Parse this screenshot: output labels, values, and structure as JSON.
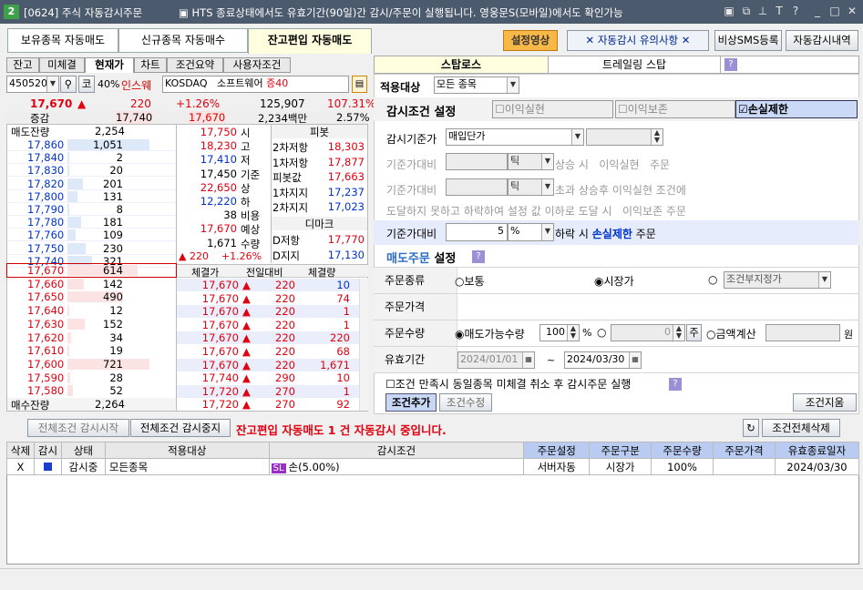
{
  "window": {
    "num": "2",
    "title": "[0624] 주식 자동감시주문",
    "message": "▣ HTS 종료상태에서도 유효기간(90일)간 감시/주문이 실행됩니다. 영웅문S(모바일)에서도 확인가능",
    "icons": [
      "window-icon",
      "restore-icon",
      "pin-icon",
      "font-size-icon",
      "help-icon",
      "minimize-icon",
      "maximize-icon",
      "close-icon"
    ]
  },
  "tabs": [
    "보유종목 자동매도",
    "신규종목 자동매수",
    "잔고편입 자동매도"
  ],
  "top_buttons": {
    "video": "설정영상",
    "caution": "✕ 자동감시 유의사항 ✕",
    "sms": "비상SMS등록",
    "history": "자동감시내역"
  },
  "left_tabs": [
    "잔고",
    "미체결",
    "현재가",
    "차트",
    "조건요약",
    "사용자조건"
  ],
  "stock": {
    "code": "450520",
    "pct_btn": "40%",
    "name_tag": "인스웨",
    "market": "KOSDAQ",
    "sector": "소프트웨어",
    "margin": "증40"
  },
  "price_row1": {
    "price": "17,670",
    "arrow": "▲",
    "change": "220",
    "rate": "+1.26%",
    "volume": "125,907",
    "volume_rate": "107.31%"
  },
  "price_row2": {
    "label": "증감",
    "prev": "17,740",
    "cur": "17,670",
    "amount": "2,234백만",
    "ratio": "2.57%"
  },
  "asks_header": {
    "label": "매도잔량",
    "total": "2,254"
  },
  "asks": [
    [
      "17,860",
      "1,051"
    ],
    [
      "17,840",
      "2"
    ],
    [
      "17,830",
      "20"
    ],
    [
      "17,820",
      "201"
    ],
    [
      "17,800",
      "131"
    ],
    [
      "17,790",
      "8"
    ],
    [
      "17,780",
      "181"
    ],
    [
      "17,760",
      "109"
    ],
    [
      "17,750",
      "230"
    ],
    [
      "17,740",
      "321"
    ]
  ],
  "bids": [
    [
      "17,670",
      "614"
    ],
    [
      "17,660",
      "142"
    ],
    [
      "17,650",
      "490"
    ],
    [
      "17,640",
      "12"
    ],
    [
      "17,630",
      "152"
    ],
    [
      "17,620",
      "34"
    ],
    [
      "17,610",
      "19"
    ],
    [
      "17,600",
      "721"
    ],
    [
      "17,590",
      "28"
    ],
    [
      "17,580",
      "52"
    ]
  ],
  "bids_footer": {
    "label": "매수잔량",
    "total": "2,264"
  },
  "info": [
    [
      "17,750",
      "시"
    ],
    [
      "18,230",
      "고"
    ],
    [
      "17,410",
      "저"
    ],
    [
      "17,450",
      "기준"
    ],
    [
      "22,650",
      "상"
    ],
    [
      "12,220",
      "하"
    ],
    [
      "38",
      "비용"
    ],
    [
      "17,670",
      "예상"
    ],
    [
      "1,671",
      "수량"
    ]
  ],
  "info_last": {
    "arrow": "▲",
    "change": "220",
    "rate": "+1.26%"
  },
  "pivot": {
    "header": "피봇",
    "rows": [
      [
        "2차저항",
        "18,303"
      ],
      [
        "1차저항",
        "17,877"
      ],
      [
        "피봇값",
        "17,663"
      ],
      [
        "1차지지",
        "17,237"
      ],
      [
        "2차지지",
        "17,023"
      ]
    ],
    "demark": "디마크",
    "demark_rows": [
      [
        "D저항",
        "17,770"
      ],
      [
        "D지지",
        "17,130"
      ]
    ]
  },
  "trades_header": [
    "체결가",
    "전일대비",
    "체결량"
  ],
  "trades": [
    [
      "17,670",
      "220",
      "10"
    ],
    [
      "17,670",
      "220",
      "74"
    ],
    [
      "17,670",
      "220",
      "1"
    ],
    [
      "17,670",
      "220",
      "1"
    ],
    [
      "17,670",
      "220",
      "220"
    ],
    [
      "17,670",
      "220",
      "68"
    ],
    [
      "17,670",
      "220",
      "1,671"
    ],
    [
      "17,740",
      "290",
      "10"
    ],
    [
      "17,720",
      "270",
      "1"
    ],
    [
      "17,720",
      "270",
      "92"
    ]
  ],
  "right_tabs": [
    "스탑로스",
    "트레일링 스탑"
  ],
  "target": {
    "label": "적용대상",
    "value": "모든 종목"
  },
  "cond": {
    "label": "감시조건 설정",
    "opt1": "이익실현",
    "opt2": "이익보존",
    "opt3": "손실제한"
  },
  "base": {
    "label": "감시기준가",
    "value": "매입단가"
  },
  "line1": {
    "label": "기준가대비",
    "unit": "틱",
    "text": "상승 시   이익실현   주문"
  },
  "line2": {
    "label": "기준가대비",
    "unit": "틱",
    "text": "초과 상승후 이익실현 조건에"
  },
  "line3": {
    "text": "도달하지 못하고 하락하여 설정 값 이하로 도달 시   이익보존 주문"
  },
  "line4": {
    "label": "기준가대비",
    "value": "5",
    "unit": "%",
    "text1": "하락 시",
    "text2": "손실제한",
    "text3": "주문"
  },
  "sell_order": {
    "title1": "매도주문",
    "title2": "설정"
  },
  "order_type": {
    "label": "주문종류",
    "opt1": "보통",
    "opt2": "시장가",
    "opt3": "조건부지정가"
  },
  "order_price": {
    "label": "주문가격"
  },
  "order_qty": {
    "label": "주문수량",
    "opt1": "매도가능수량",
    "value": "100",
    "pct": "%",
    "qty": "0",
    "unit": "주",
    "opt3": "금액계산",
    "won": "원"
  },
  "valid": {
    "label": "유효기간",
    "from": "2024/01/01",
    "tilde": "~",
    "to": "2024/03/30"
  },
  "check_cancel": "조건 만족시 동일종목 미체결 취소 후 감시주문 실행",
  "cond_buttons": {
    "add": "조건추가",
    "modify": "조건수정",
    "clear": "조건지움"
  },
  "watch_bar": {
    "start": "전체조건 감시시작",
    "stop": "전체조건 감시중지",
    "status": "잔고편입 자동매도 1 건 자동감시 중입니다.",
    "delete_all": "조건전체삭제"
  },
  "grid_headers": [
    "삭제",
    "감시",
    "상태",
    "적용대상",
    "감시조건",
    "주문설정",
    "주문구분",
    "주문수량",
    "주문가격",
    "유효종료일자"
  ],
  "grid_rows": [
    {
      "del": "X",
      "state": "감시중",
      "target": "모든종목",
      "badge": "SL",
      "cond": "손(5.00%)",
      "setting": "서버자동",
      "kind": "시장가",
      "qty": "100%",
      "price": "",
      "end": "2024/03/30"
    }
  ],
  "colors": {
    "title_bg": "#4b5a6c",
    "ask_bg": "#dde8f8",
    "bid_bg": "#fbe3e3",
    "red": "#e0000f",
    "blue": "#0033cc",
    "highlight": "#e6ecfb"
  }
}
